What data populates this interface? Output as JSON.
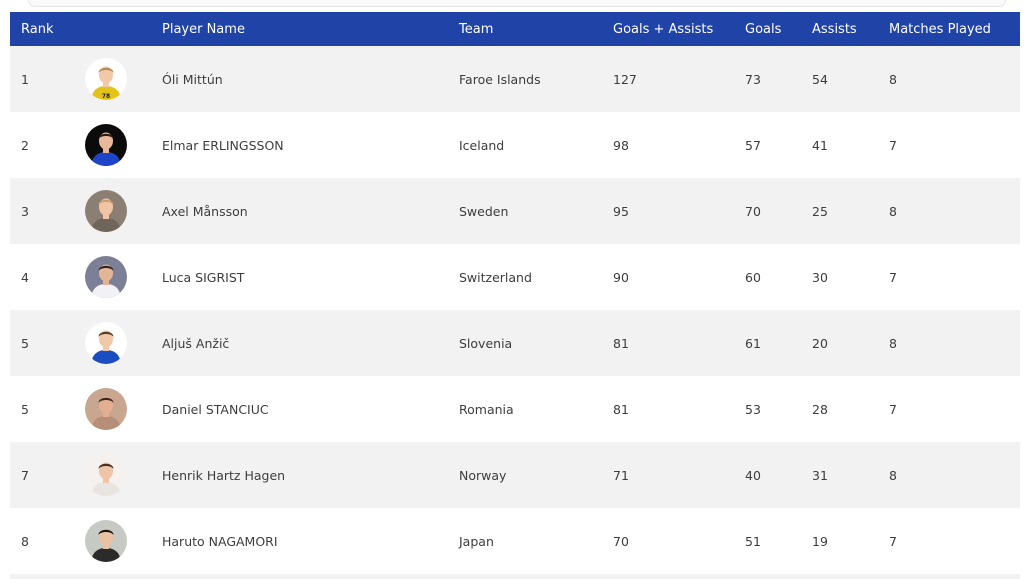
{
  "columns": {
    "rank": "Rank",
    "player_name": "Player Name",
    "team": "Team",
    "goals_assists": "Goals + Assists",
    "goals": "Goals",
    "assists": "Assists",
    "matches_played": "Matches Played"
  },
  "rows": [
    {
      "rank": "1",
      "name": "Óli Mittún",
      "team": "Faroe Islands",
      "goals_assists": "127",
      "goals": "73",
      "assists": "54",
      "matches": "8",
      "avatar_bg": "#ffffff",
      "shirt": "#e3c31a",
      "skin": "#f1c9a8",
      "hair": "#b98a55",
      "photo_text": "78"
    },
    {
      "rank": "2",
      "name": "Elmar ERLINGSSON",
      "team": "Iceland",
      "goals_assists": "98",
      "goals": "57",
      "assists": "41",
      "matches": "7",
      "avatar_bg": "#0b0b0b",
      "shirt": "#1e45c8",
      "skin": "#e8b898",
      "hair": "#2a1e16"
    },
    {
      "rank": "3",
      "name": "Axel Månsson",
      "team": "Sweden",
      "goals_assists": "95",
      "goals": "70",
      "assists": "25",
      "matches": "8",
      "avatar_bg": "#8a7f72",
      "shirt": "#6f655a",
      "skin": "#f0c4a4",
      "hair": "#c9a070"
    },
    {
      "rank": "4",
      "name": "Luca SIGRIST",
      "team": "Switzerland",
      "goals_assists": "90",
      "goals": "60",
      "assists": "30",
      "matches": "7",
      "avatar_bg": "#7c7f95",
      "shirt": "#f2f2f6",
      "skin": "#e4b497",
      "hair": "#2c241e"
    },
    {
      "rank": "5",
      "name": "Aljuš Anžič",
      "team": "Slovenia",
      "goals_assists": "81",
      "goals": "61",
      "assists": "20",
      "matches": "8",
      "avatar_bg": "#ffffff",
      "shirt": "#1a4dbf",
      "skin": "#f1c8a8",
      "hair": "#5b3e26"
    },
    {
      "rank": "5",
      "name": "Daniel STANCIUC",
      "team": "Romania",
      "goals_assists": "81",
      "goals": "53",
      "assists": "28",
      "matches": "7",
      "avatar_bg": "#c9a690",
      "shirt": "#b78f78",
      "skin": "#e3ae92",
      "hair": "#3c2a20"
    },
    {
      "rank": "7",
      "name": "Henrik Hartz Hagen",
      "team": "Norway",
      "goals_assists": "71",
      "goals": "40",
      "assists": "31",
      "matches": "8",
      "avatar_bg": "#f4f1ee",
      "shirt": "#e9e5e1",
      "skin": "#f0c4a6",
      "hair": "#4a3022"
    },
    {
      "rank": "8",
      "name": "Haruto NAGAMORI",
      "team": "Japan",
      "goals_assists": "70",
      "goals": "51",
      "assists": "19",
      "matches": "7",
      "avatar_bg": "#c7c9c4",
      "shirt": "#2b2b2b",
      "skin": "#e9c2a2",
      "hair": "#141414"
    }
  ],
  "colors": {
    "header_bg": "#1f43a6",
    "row_stripe": "#f2f2f2",
    "text": "#3d3d3d"
  }
}
